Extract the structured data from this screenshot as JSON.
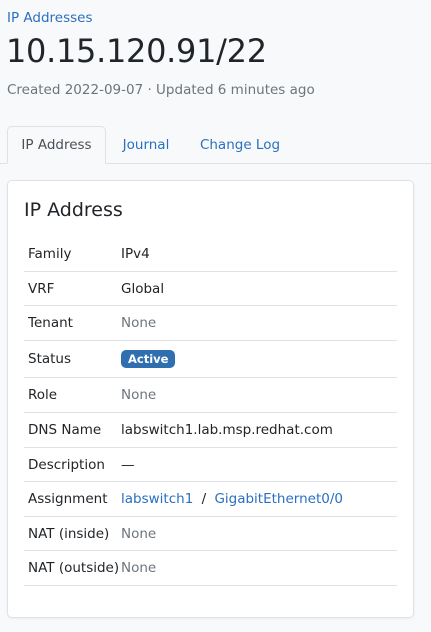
{
  "breadcrumb": {
    "label": "IP Addresses"
  },
  "title": "10.15.120.91/22",
  "meta": {
    "text": "Created 2022-09-07 · Updated 6 minutes ago"
  },
  "tabs": [
    {
      "label": "IP Address",
      "active": true
    },
    {
      "label": "Journal",
      "active": false
    },
    {
      "label": "Change Log",
      "active": false
    }
  ],
  "card": {
    "title": "IP Address",
    "rows": [
      {
        "key": "Family",
        "value": "IPv4"
      },
      {
        "key": "VRF",
        "value": "Global"
      },
      {
        "key": "Tenant",
        "value": "None"
      },
      {
        "key": "Status",
        "value": "Active"
      },
      {
        "key": "Role",
        "value": "None"
      },
      {
        "key": "DNS Name",
        "value": "labswitch1.lab.msp.redhat.com"
      },
      {
        "key": "Description",
        "value": "—"
      },
      {
        "key": "Assignment",
        "device": "labswitch1",
        "separator": "/",
        "interface": "GigabitEthernet0/0"
      },
      {
        "key": "NAT (inside)",
        "value": "None"
      },
      {
        "key": "NAT (outside)",
        "value": "None"
      }
    ]
  },
  "colors": {
    "link": "#2a70c0",
    "status_active": "#2f6fb0",
    "muted": "#6c757d"
  }
}
